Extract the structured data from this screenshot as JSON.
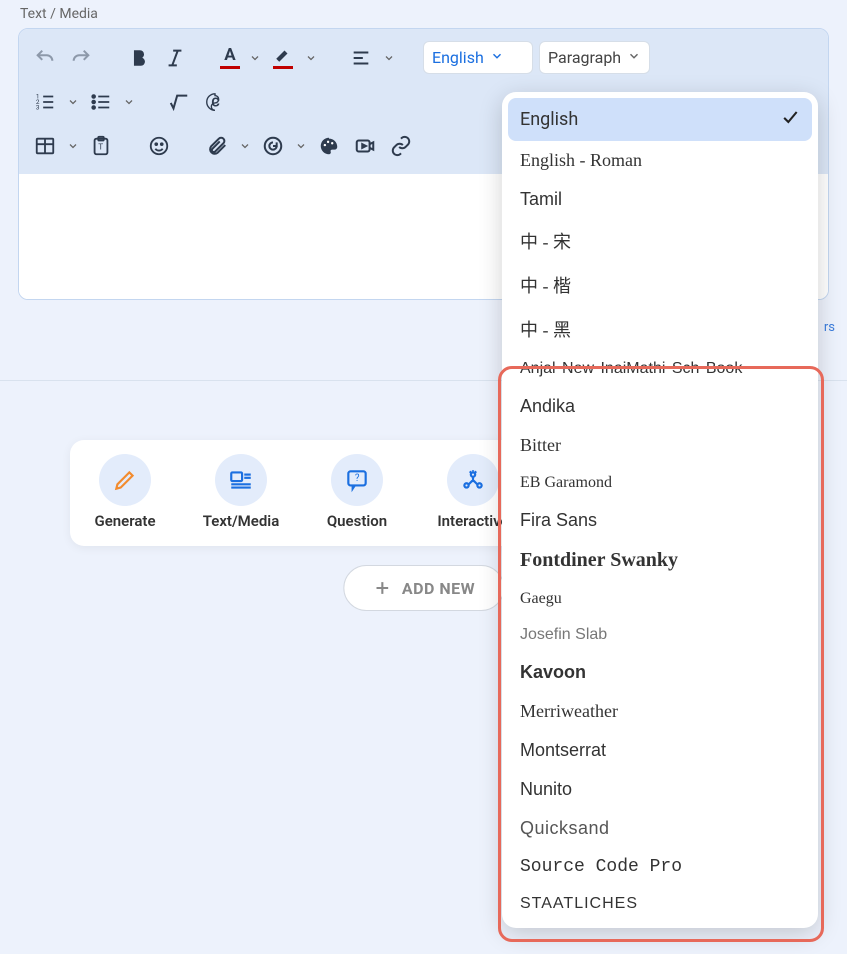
{
  "header": {
    "title": "Text / Media"
  },
  "toolbar": {
    "font_select": "English",
    "style_select": "Paragraph"
  },
  "edge_label": "rs",
  "actions": {
    "generate": "Generate",
    "text_media": "Text/Media",
    "question": "Question",
    "interactive": "Interactive"
  },
  "add_new": "ADD NEW",
  "font_dropdown": {
    "items": [
      {
        "label": "English",
        "selected": true,
        "cls": ""
      },
      {
        "label": "English - Roman",
        "cls": "font-english-roman"
      },
      {
        "label": "Tamil",
        "cls": "font-tamil"
      },
      {
        "label": "中 - 宋",
        "cls": "font-cjk"
      },
      {
        "label": "中 - 楷",
        "cls": "font-cjk"
      },
      {
        "label": "中 - 黑",
        "cls": "font-cjk"
      },
      {
        "label": "Anjal New InaiMathi Sch Book",
        "cls": "font-anjal"
      },
      {
        "label": "Andika",
        "cls": "font-andika"
      },
      {
        "label": "Bitter",
        "cls": "font-bitter"
      },
      {
        "label": "EB Garamond",
        "cls": "font-garamond"
      },
      {
        "label": "Fira Sans",
        "cls": "font-fira"
      },
      {
        "label": "Fontdiner Swanky",
        "cls": "font-swanky"
      },
      {
        "label": "Gaegu",
        "cls": "font-gaegu"
      },
      {
        "label": "Josefin Slab",
        "cls": "font-josefin"
      },
      {
        "label": "Kavoon",
        "cls": "font-kavoon"
      },
      {
        "label": "Merriweather",
        "cls": "font-merri"
      },
      {
        "label": "Montserrat",
        "cls": "font-mont"
      },
      {
        "label": "Nunito",
        "cls": "font-nunito"
      },
      {
        "label": "Quicksand",
        "cls": "font-quick"
      },
      {
        "label": "Source Code Pro",
        "cls": "font-source"
      },
      {
        "label": "Staatliches",
        "cls": "font-staat"
      }
    ]
  }
}
